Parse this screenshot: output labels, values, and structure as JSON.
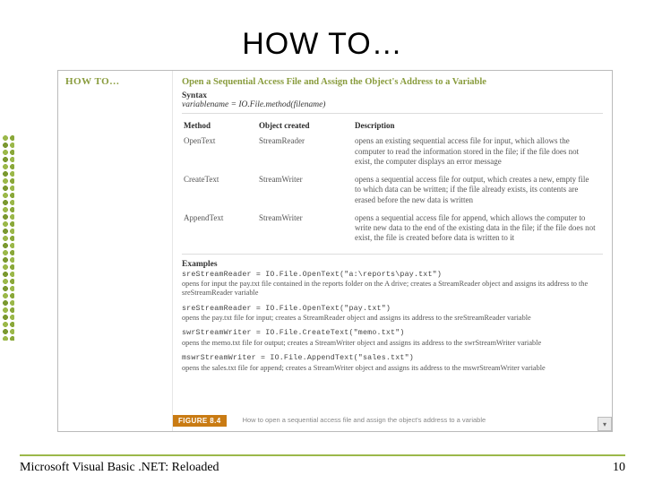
{
  "title": "HOW TO…",
  "panel": {
    "left_heading": "HOW TO…",
    "heading": "Open a Sequential Access File and Assign the Object's Address to a Variable",
    "syntax_label": "Syntax",
    "syntax_line": "variablename = IO.File.method(filename)",
    "columns": {
      "c1": "Method",
      "c2": "Object created",
      "c3": "Description"
    },
    "rows": [
      {
        "method": "OpenText",
        "object": "StreamReader",
        "desc": "opens an existing sequential access file for input, which allows the computer to read the information stored in the file; if the file does not exist, the computer displays an error message"
      },
      {
        "method": "CreateText",
        "object": "StreamWriter",
        "desc": "opens a sequential access file for output, which creates a new, empty file to which data can be written; if the file already exists, its contents are erased before the new data is written"
      },
      {
        "method": "AppendText",
        "object": "StreamWriter",
        "desc": "opens a sequential access file for append, which allows the computer to write new data to the end of the existing data in the file; if the file does not exist, the file is created before data is written to it"
      }
    ],
    "examples_label": "Examples",
    "examples": [
      {
        "code": "sreStreamReader = IO.File.OpenText(\"a:\\reports\\pay.txt\")",
        "desc": "opens for input the pay.txt file contained in the reports folder on the A drive; creates a StreamReader object and assigns its address to the sreStreamReader variable"
      },
      {
        "code": "sreStreamReader = IO.File.OpenText(\"pay.txt\")",
        "desc": "opens the pay.txt file for input; creates a StreamReader object and assigns its address to the sreStreamReader variable"
      },
      {
        "code": "swrStreamWriter = IO.File.CreateText(\"memo.txt\")",
        "desc": "opens the memo.txt file for output; creates a StreamWriter object and assigns its address to the swrStreamWriter variable"
      },
      {
        "code": "mswrStreamWriter = IO.File.AppendText(\"sales.txt\")",
        "desc": "opens the sales.txt file for append; creates a StreamWriter object and assigns its address to the mswrStreamWriter variable"
      }
    ],
    "figure_tag": "FIGURE 8.4",
    "figure_caption": "How to open a sequential access file and assign the object's address to a variable"
  },
  "footer": {
    "left": "Microsoft Visual Basic .NET: Reloaded",
    "right": "10"
  }
}
